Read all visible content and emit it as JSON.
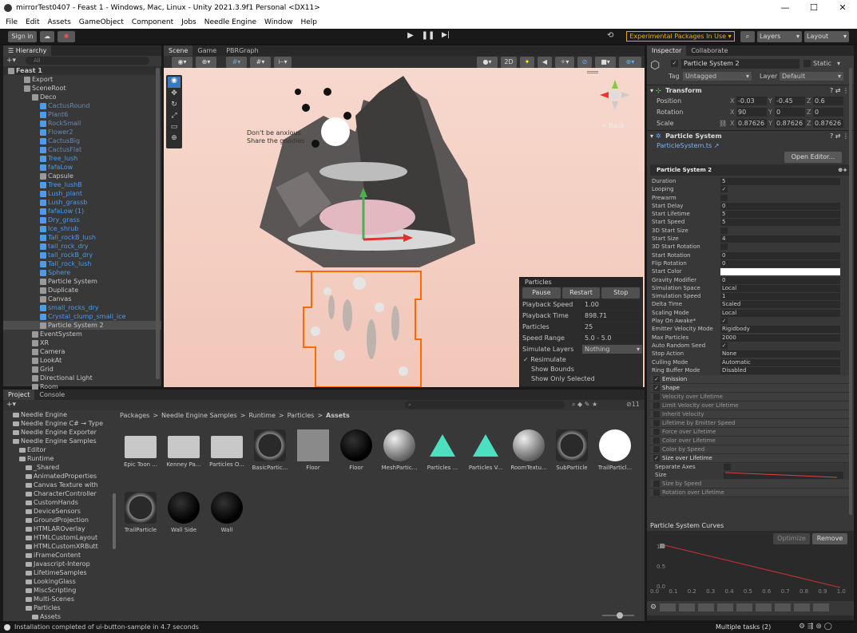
{
  "window": {
    "title": "mirrorTest0407 - Feast 1 - Windows, Mac, Linux - Unity 2021.3.9f1 Personal <DX11>"
  },
  "menu": [
    "File",
    "Edit",
    "Assets",
    "GameObject",
    "Component",
    "Jobs",
    "Needle Engine",
    "Window",
    "Help"
  ],
  "toolbar": {
    "sign_in": "Sign in",
    "experimental": "Experimental Packages In Use ▾",
    "layers": "Layers",
    "layout": "Layout"
  },
  "hierarchy": {
    "tab": "Hierarchy",
    "search_placeholder": "All",
    "rows": [
      {
        "label": "Feast 1",
        "indent": 0,
        "style": "scene"
      },
      {
        "label": "Export",
        "indent": 2,
        "style": "normal"
      },
      {
        "label": "SceneRoot",
        "indent": 2,
        "style": "normal"
      },
      {
        "label": "Deco",
        "indent": 3,
        "style": "normal"
      },
      {
        "label": "CactusRound",
        "indent": 4,
        "style": "dim"
      },
      {
        "label": "Plant6",
        "indent": 4,
        "style": "dim"
      },
      {
        "label": "RockSmall",
        "indent": 4,
        "style": "dim"
      },
      {
        "label": "Flower2",
        "indent": 4,
        "style": "dim"
      },
      {
        "label": "CactusBig",
        "indent": 4,
        "style": "dim"
      },
      {
        "label": "CactusFlat",
        "indent": 4,
        "style": "dim"
      },
      {
        "label": "Tree_lush",
        "indent": 4,
        "style": "blue"
      },
      {
        "label": "fafaLow",
        "indent": 4,
        "style": "blue"
      },
      {
        "label": "Capsule",
        "indent": 4,
        "style": "normal"
      },
      {
        "label": "Tree_lushB",
        "indent": 4,
        "style": "blue"
      },
      {
        "label": "Lush_plant",
        "indent": 4,
        "style": "blue"
      },
      {
        "label": "Lush_grassb",
        "indent": 4,
        "style": "blue"
      },
      {
        "label": "fafaLow (1)",
        "indent": 4,
        "style": "blue"
      },
      {
        "label": "Dry_grass",
        "indent": 4,
        "style": "blue"
      },
      {
        "label": "Ice_shrub",
        "indent": 4,
        "style": "blue"
      },
      {
        "label": "Tall_rockB_lush",
        "indent": 4,
        "style": "blue"
      },
      {
        "label": "tall_rock_dry",
        "indent": 4,
        "style": "blue"
      },
      {
        "label": "tall_rockB_dry",
        "indent": 4,
        "style": "blue"
      },
      {
        "label": "Tall_rock_lush",
        "indent": 4,
        "style": "blue"
      },
      {
        "label": "Sphere",
        "indent": 4,
        "style": "blue"
      },
      {
        "label": "Particle System",
        "indent": 4,
        "style": "normal"
      },
      {
        "label": "Duplicate",
        "indent": 4,
        "style": "normal"
      },
      {
        "label": "Canvas",
        "indent": 4,
        "style": "normal"
      },
      {
        "label": "small_rocks_dry",
        "indent": 4,
        "style": "blue"
      },
      {
        "label": "Crystal_clump_small_ice",
        "indent": 4,
        "style": "blue"
      },
      {
        "label": "Particle System 2",
        "indent": 4,
        "style": "sel"
      },
      {
        "label": "EventSystem",
        "indent": 3,
        "style": "normal"
      },
      {
        "label": "XR",
        "indent": 3,
        "style": "normal"
      },
      {
        "label": "Camera",
        "indent": 3,
        "style": "normal"
      },
      {
        "label": "LookAt",
        "indent": 3,
        "style": "normal"
      },
      {
        "label": "Grid",
        "indent": 3,
        "style": "normal"
      },
      {
        "label": "Directional Light",
        "indent": 3,
        "style": "normal"
      },
      {
        "label": "Room",
        "indent": 3,
        "style": "normal"
      }
    ]
  },
  "scene": {
    "tabs": [
      "Scene",
      "Game",
      "PBRGraph"
    ],
    "mode_2d": "2D",
    "gizmo_label": "< Back",
    "overlay_text1": "Don't be anxious",
    "overlay_text2": "Share the goodies"
  },
  "particles_overlay": {
    "title": "Particles",
    "buttons": [
      "Pause",
      "Restart",
      "Stop"
    ],
    "rows": [
      {
        "label": "Playback Speed",
        "value": "1.00"
      },
      {
        "label": "Playback Time",
        "value": "898.71"
      },
      {
        "label": "Particles",
        "value": "25"
      },
      {
        "label": "Speed Range",
        "value": "5.0 - 5.0"
      }
    ],
    "simulate_layers_label": "Simulate Layers",
    "simulate_layers_value": "Nothing",
    "resimulate": "Resimulate",
    "show_bounds": "Show Bounds",
    "show_only_selected": "Show Only Selected"
  },
  "project": {
    "tabs": [
      "Project",
      "Console"
    ],
    "breadcrumb": [
      "Packages",
      "Needle Engine Samples",
      "Runtime",
      "Particles",
      "Assets"
    ],
    "badge": "11",
    "tree": [
      {
        "label": "Needle Engine",
        "indent": 1
      },
      {
        "label": "Needle Engine C# → Type",
        "indent": 1
      },
      {
        "label": "Needle Engine Exporter",
        "indent": 1
      },
      {
        "label": "Needle Engine Samples",
        "indent": 1
      },
      {
        "label": "Editor",
        "indent": 2
      },
      {
        "label": "Runtime",
        "indent": 2
      },
      {
        "label": "_Shared",
        "indent": 3
      },
      {
        "label": "AnimatedProperties",
        "indent": 3
      },
      {
        "label": "Canvas Texture with",
        "indent": 3
      },
      {
        "label": "CharacterController",
        "indent": 3
      },
      {
        "label": "CustomHands",
        "indent": 3
      },
      {
        "label": "DeviceSensors",
        "indent": 3
      },
      {
        "label": "GroundProjection",
        "indent": 3
      },
      {
        "label": "HTMLAROverlay",
        "indent": 3
      },
      {
        "label": "HTMLCustomLayout",
        "indent": 3
      },
      {
        "label": "HTMLCustomXRButt",
        "indent": 3
      },
      {
        "label": "iFrameContent",
        "indent": 3
      },
      {
        "label": "Javascript-Interop",
        "indent": 3
      },
      {
        "label": "LifetimeSamples",
        "indent": 3
      },
      {
        "label": "LookingGlass",
        "indent": 3
      },
      {
        "label": "MiscScripting",
        "indent": 3
      },
      {
        "label": "Multi-Scenes",
        "indent": 3
      },
      {
        "label": "Particles",
        "indent": 3
      },
      {
        "label": "Assets",
        "indent": 4
      }
    ],
    "assets": [
      {
        "label": "Epic Toon ...",
        "kind": "folder"
      },
      {
        "label": "Kenney Pa...",
        "kind": "folder"
      },
      {
        "label": "Particles O...",
        "kind": "folder"
      },
      {
        "label": "BasicPartic...",
        "kind": "ring"
      },
      {
        "label": "Floor",
        "kind": "gray"
      },
      {
        "label": "Floor",
        "kind": "black"
      },
      {
        "label": "MeshPartic...",
        "kind": "sphere"
      },
      {
        "label": "Particles ...",
        "kind": "teal"
      },
      {
        "label": "Particles V...",
        "kind": "teal"
      },
      {
        "label": "RoomTextu...",
        "kind": "sphere"
      },
      {
        "label": "SubParticle",
        "kind": "ring"
      },
      {
        "label": "TrailParticl...",
        "kind": "white"
      },
      {
        "label": "TrailParticle",
        "kind": "ring"
      },
      {
        "label": "Wall Side",
        "kind": "black"
      },
      {
        "label": "Wall",
        "kind": "black"
      }
    ]
  },
  "inspector": {
    "tabs": [
      "Inspector",
      "Collaborate"
    ],
    "object_name": "Particle System 2",
    "static_label": "Static",
    "tag_label": "Tag",
    "tag_value": "Untagged",
    "layer_label": "Layer",
    "layer_value": "Default",
    "transform": {
      "title": "Transform",
      "position": {
        "label": "Position",
        "x": "-0.03",
        "y": "-0.45",
        "z": "0.6"
      },
      "rotation": {
        "label": "Rotation",
        "x": "90",
        "y": "0",
        "z": "0"
      },
      "scale": {
        "label": "Scale",
        "x": "0.87626",
        "y": "0.87626",
        "z": "0.87626"
      }
    },
    "particle_system": {
      "title": "Particle System",
      "script": "ParticleSystem.ts ↗",
      "open_editor": "Open Editor...",
      "header": "Particle System 2"
    },
    "props": [
      {
        "label": "Duration",
        "value": "5",
        "type": "field"
      },
      {
        "label": "Looping",
        "value": "✓",
        "type": "check"
      },
      {
        "label": "Prewarm",
        "value": "",
        "type": "check"
      },
      {
        "label": "Start Delay",
        "value": "0",
        "type": "field"
      },
      {
        "label": "Start Lifetime",
        "value": "5",
        "type": "field"
      },
      {
        "label": "Start Speed",
        "value": "5",
        "type": "field"
      },
      {
        "label": "3D Start Size",
        "value": "",
        "type": "check"
      },
      {
        "label": "Start Size",
        "value": "4",
        "type": "field"
      },
      {
        "label": "3D Start Rotation",
        "value": "",
        "type": "check"
      },
      {
        "label": "Start Rotation",
        "value": "0",
        "type": "field"
      },
      {
        "label": "Flip Rotation",
        "value": "0",
        "type": "field"
      },
      {
        "label": "Start Color",
        "value": "",
        "type": "color"
      },
      {
        "label": "Gravity Modifier",
        "value": "0",
        "type": "field"
      },
      {
        "label": "Simulation Space",
        "value": "Local",
        "type": "field"
      },
      {
        "label": "Simulation Speed",
        "value": "1",
        "type": "field"
      },
      {
        "label": "Delta Time",
        "value": "Scaled",
        "type": "field"
      },
      {
        "label": "Scaling Mode",
        "value": "Local",
        "type": "field"
      },
      {
        "label": "Play On Awake*",
        "value": "✓",
        "type": "check"
      },
      {
        "label": "Emitter Velocity Mode",
        "value": "Rigidbody",
        "type": "field"
      },
      {
        "label": "Max Particles",
        "value": "2000",
        "type": "field"
      },
      {
        "label": "Auto Random Seed",
        "value": "✓",
        "type": "check"
      },
      {
        "label": "Stop Action",
        "value": "None",
        "type": "field"
      },
      {
        "label": "Culling Mode",
        "value": "Automatic",
        "type": "field"
      },
      {
        "label": "Ring Buffer Mode",
        "value": "Disabled",
        "type": "field"
      }
    ],
    "modules": [
      {
        "label": "Emission",
        "on": true
      },
      {
        "label": "Shape",
        "on": true
      },
      {
        "label": "Velocity over Lifetime",
        "on": false
      },
      {
        "label": "Limit Velocity over Lifetime",
        "on": false
      },
      {
        "label": "Inherit Velocity",
        "on": false
      },
      {
        "label": "Lifetime by Emitter Speed",
        "on": false
      },
      {
        "label": "Force over Lifetime",
        "on": false
      },
      {
        "label": "Color over Lifetime",
        "on": false
      },
      {
        "label": "Color by Speed",
        "on": false
      },
      {
        "label": "Size over Lifetime",
        "on": true
      }
    ],
    "sol_separate_axes": "Separate Axes",
    "sol_size": "Size",
    "modules_after": [
      {
        "label": "Size by Speed",
        "on": false
      },
      {
        "label": "Rotation over Lifetime",
        "on": false
      }
    ],
    "curves": {
      "title": "Particle System Curves",
      "optimize": "Optimize",
      "remove": "Remove",
      "y_ticks": [
        "1.0",
        "0.5",
        "0.0"
      ],
      "x_ticks": [
        "0.0",
        "0.1",
        "0.2",
        "0.3",
        "0.4",
        "0.5",
        "0.6",
        "0.7",
        "0.8",
        "0.9",
        "1.0"
      ]
    }
  },
  "status": {
    "message": "Installation completed of ui-button-sample in 4.7 seconds",
    "tasks": "Multiple tasks (2)"
  }
}
